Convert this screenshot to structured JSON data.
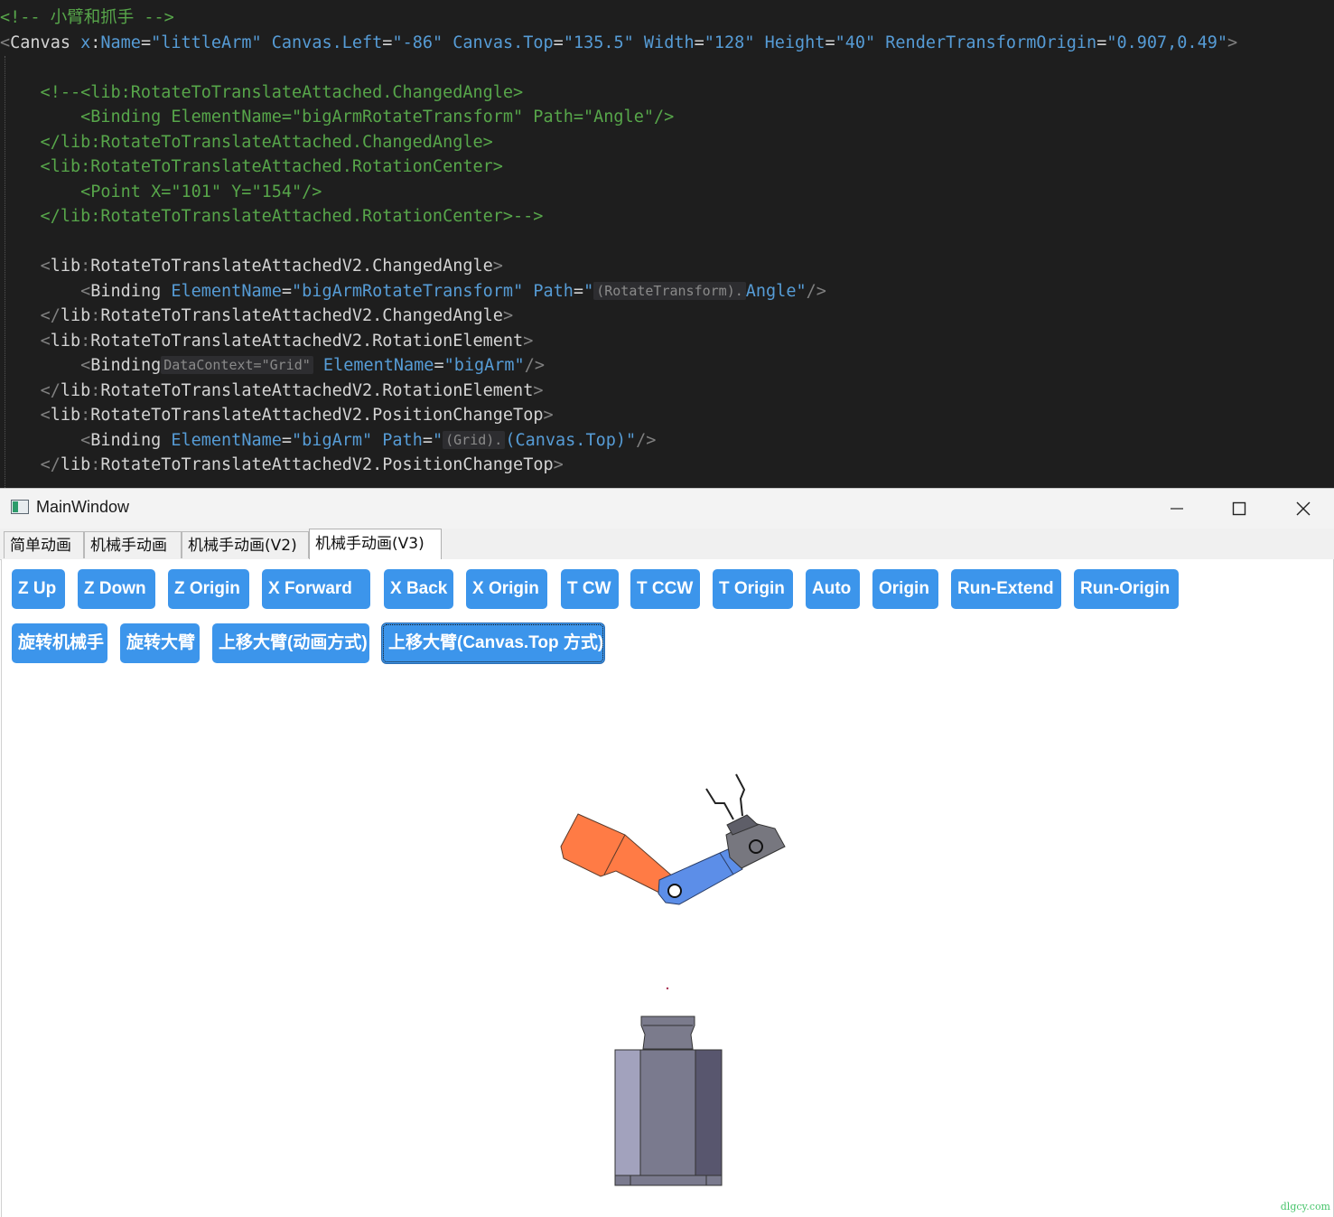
{
  "editor": {
    "lines": [
      [
        [
          "c-cmt",
          "<!-- 小臂和抓手 -->"
        ]
      ],
      [
        [
          "c-br",
          "<"
        ],
        [
          "c-el",
          "Canvas "
        ],
        [
          "c-at",
          "x"
        ],
        [
          "c-pun",
          ":"
        ],
        [
          "c-at",
          "Name"
        ],
        [
          "c-pun",
          "="
        ],
        [
          "c-val",
          "\"littleArm\""
        ],
        [
          "c-pun",
          " "
        ],
        [
          "c-at",
          "Canvas.Left"
        ],
        [
          "c-pun",
          "="
        ],
        [
          "c-val",
          "\"-86\""
        ],
        [
          "c-pun",
          " "
        ],
        [
          "c-at",
          "Canvas.Top"
        ],
        [
          "c-pun",
          "="
        ],
        [
          "c-val",
          "\"135.5\""
        ],
        [
          "c-pun",
          " "
        ],
        [
          "c-at",
          "Width"
        ],
        [
          "c-pun",
          "="
        ],
        [
          "c-val",
          "\"128\""
        ],
        [
          "c-pun",
          " "
        ],
        [
          "c-at",
          "Height"
        ],
        [
          "c-pun",
          "="
        ],
        [
          "c-val",
          "\"40\""
        ],
        [
          "c-pun",
          " "
        ],
        [
          "c-at",
          "RenderTransformOrigin"
        ],
        [
          "c-pun",
          "="
        ],
        [
          "c-val",
          "\"0.907,0.49\""
        ],
        [
          "c-br",
          ">"
        ]
      ],
      [],
      [
        [
          "c-cmt",
          "    <!--<lib:RotateToTranslateAttached.ChangedAngle>"
        ]
      ],
      [
        [
          "c-cmt",
          "        <Binding ElementName=\"bigArmRotateTransform\" Path=\"Angle\"/>"
        ]
      ],
      [
        [
          "c-cmt",
          "    </lib:RotateToTranslateAttached.ChangedAngle>"
        ]
      ],
      [
        [
          "c-cmt",
          "    <lib:RotateToTranslateAttached.RotationCenter>"
        ]
      ],
      [
        [
          "c-cmt",
          "        <Point X=\"101\" Y=\"154\"/>"
        ]
      ],
      [
        [
          "c-cmt",
          "    </lib:RotateToTranslateAttached.RotationCenter>-->"
        ]
      ],
      [],
      [
        [
          "c-pun",
          "    "
        ],
        [
          "c-br",
          "<"
        ],
        [
          "c-el",
          "lib"
        ],
        [
          "c-br",
          ":"
        ],
        [
          "c-el",
          "RotateToTranslateAttachedV2.ChangedAngle"
        ],
        [
          "c-br",
          ">"
        ]
      ],
      [
        [
          "c-pun",
          "        "
        ],
        [
          "c-br",
          "<"
        ],
        [
          "c-el",
          "Binding "
        ],
        [
          "c-at",
          "ElementName"
        ],
        [
          "c-pun",
          "="
        ],
        [
          "c-val",
          "\"bigArmRotateTransform\""
        ],
        [
          "c-pun",
          " "
        ],
        [
          "c-at",
          "Path"
        ],
        [
          "c-pun",
          "="
        ],
        [
          "c-val",
          "\""
        ],
        [
          "hint",
          "(RotateTransform)."
        ],
        [
          "c-val",
          "Angle\""
        ],
        [
          "c-br",
          "/>"
        ]
      ],
      [
        [
          "c-pun",
          "    "
        ],
        [
          "c-br",
          "</"
        ],
        [
          "c-el",
          "lib"
        ],
        [
          "c-br",
          ":"
        ],
        [
          "c-el",
          "RotateToTranslateAttachedV2.ChangedAngle"
        ],
        [
          "c-br",
          ">"
        ]
      ],
      [
        [
          "c-pun",
          "    "
        ],
        [
          "c-br",
          "<"
        ],
        [
          "c-el",
          "lib"
        ],
        [
          "c-br",
          ":"
        ],
        [
          "c-el",
          "RotateToTranslateAttachedV2.RotationElement"
        ],
        [
          "c-br",
          ">"
        ]
      ],
      [
        [
          "c-pun",
          "        "
        ],
        [
          "c-br",
          "<"
        ],
        [
          "c-el",
          "Binding"
        ],
        [
          "hint",
          "DataContext=\"Grid\""
        ],
        [
          "c-pun",
          " "
        ],
        [
          "c-at",
          "ElementName"
        ],
        [
          "c-pun",
          "="
        ],
        [
          "c-val",
          "\"bigArm\""
        ],
        [
          "c-br",
          "/>"
        ]
      ],
      [
        [
          "c-pun",
          "    "
        ],
        [
          "c-br",
          "</"
        ],
        [
          "c-el",
          "lib"
        ],
        [
          "c-br",
          ":"
        ],
        [
          "c-el",
          "RotateToTranslateAttachedV2.RotationElement"
        ],
        [
          "c-br",
          ">"
        ]
      ],
      [
        [
          "c-pun",
          "    "
        ],
        [
          "c-br",
          "<"
        ],
        [
          "c-el",
          "lib"
        ],
        [
          "c-br",
          ":"
        ],
        [
          "c-el",
          "RotateToTranslateAttachedV2.PositionChangeTop"
        ],
        [
          "c-br",
          ">"
        ]
      ],
      [
        [
          "c-pun",
          "        "
        ],
        [
          "c-br",
          "<"
        ],
        [
          "c-el",
          "Binding "
        ],
        [
          "c-at",
          "ElementName"
        ],
        [
          "c-pun",
          "="
        ],
        [
          "c-val",
          "\"bigArm\""
        ],
        [
          "c-pun",
          " "
        ],
        [
          "c-at",
          "Path"
        ],
        [
          "c-pun",
          "="
        ],
        [
          "c-val",
          "\""
        ],
        [
          "hint",
          "(Grid)."
        ],
        [
          "c-val",
          "(Canvas.Top)\""
        ],
        [
          "c-br",
          "/>"
        ]
      ],
      [
        [
          "c-pun",
          "    "
        ],
        [
          "c-br",
          "</"
        ],
        [
          "c-el",
          "lib"
        ],
        [
          "c-br",
          ":"
        ],
        [
          "c-el",
          "RotateToTranslateAttachedV2.PositionChangeTop"
        ],
        [
          "c-br",
          ">"
        ]
      ]
    ]
  },
  "window": {
    "title": "MainWindow",
    "minimize_glyph": "—",
    "maximize_glyph": "☐",
    "close_glyph": "✕"
  },
  "tabs": [
    "简单动画",
    "机械手动画",
    "机械手动画(V2)",
    "机械手动画(V3)"
  ],
  "buttons_row1": [
    "Z Up",
    "Z Down",
    "Z Origin",
    "X Forward",
    "X Back",
    "X Origin",
    "T CW",
    "T CCW",
    "T Origin",
    "Auto",
    "Origin",
    "Run-Extend",
    "Run-Origin"
  ],
  "buttons_row2": [
    "旋转机械手",
    "旋转大臂",
    "上移大臂(动画方式)",
    "上移大臂(Canvas.Top 方式)"
  ],
  "colors": {
    "button": "#3c95eb",
    "big_arm": "#ff7b45",
    "little_arm": "#5c8ee8",
    "gripper": "#77777f",
    "base_light": "#a2a2bd",
    "base_mid": "#7a7a8e",
    "base_dark": "#58566e"
  },
  "watermark": "dlgcy.com"
}
